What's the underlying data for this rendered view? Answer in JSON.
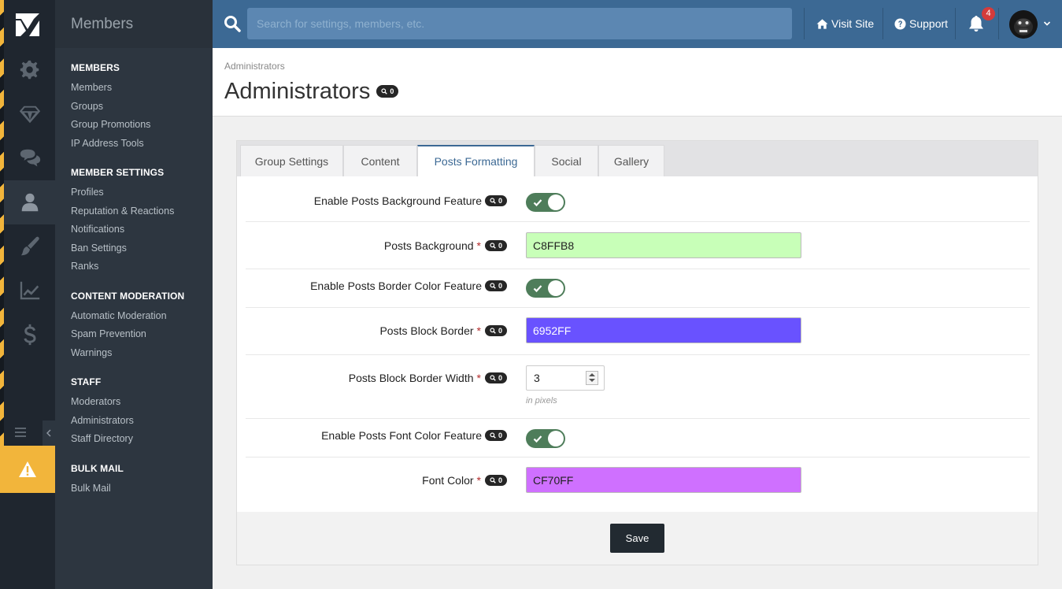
{
  "app": {
    "section_title": "Members"
  },
  "rail": {
    "items": [
      {
        "icon": "gears-icon"
      },
      {
        "icon": "diamond-icon"
      },
      {
        "icon": "chat-icon"
      },
      {
        "icon": "user-icon",
        "active": true
      },
      {
        "icon": "brush-icon"
      },
      {
        "icon": "chart-icon"
      },
      {
        "icon": "dollar-icon"
      }
    ],
    "warning_icon": "warning-icon"
  },
  "sidebar": {
    "sections": [
      {
        "title": "Members",
        "items": [
          "Members",
          "Groups",
          "Group Promotions",
          "IP Address Tools"
        ]
      },
      {
        "title": "Member Settings",
        "items": [
          "Profiles",
          "Reputation & Reactions",
          "Notifications",
          "Ban Settings",
          "Ranks"
        ]
      },
      {
        "title": "Content Moderation",
        "items": [
          "Automatic Moderation",
          "Spam Prevention",
          "Warnings"
        ]
      },
      {
        "title": "Staff",
        "items": [
          "Moderators",
          "Administrators",
          "Staff Directory"
        ]
      },
      {
        "title": "Bulk Mail",
        "items": [
          "Bulk Mail"
        ]
      }
    ]
  },
  "header": {
    "search_placeholder": "Search for settings, members, etc.",
    "visit_site": "Visit Site",
    "support": "Support",
    "notification_count": "4"
  },
  "page": {
    "breadcrumb": "Administrators",
    "title": "Administrators",
    "title_badge": "0"
  },
  "tabs": [
    {
      "label": "Group Settings"
    },
    {
      "label": "Content"
    },
    {
      "label": "Posts Formatting",
      "active": true
    },
    {
      "label": "Social"
    },
    {
      "label": "Gallery"
    }
  ],
  "form": {
    "rows": {
      "enable_bg": {
        "label": "Enable Posts Background Feature",
        "badge": "0",
        "enabled": true
      },
      "posts_bg": {
        "label": "Posts Background",
        "badge": "0",
        "value": "C8FFB8",
        "color": "#C8FFB8"
      },
      "enable_border": {
        "label": "Enable Posts Border Color Feature",
        "badge": "0",
        "enabled": true
      },
      "block_border": {
        "label": "Posts Block Border",
        "badge": "0",
        "value": "6952FF",
        "color": "#6952FF"
      },
      "border_width": {
        "label": "Posts Block Border Width",
        "badge": "0",
        "value": "3",
        "help": "in pixels"
      },
      "enable_font": {
        "label": "Enable Posts Font Color Feature",
        "badge": "0",
        "enabled": true
      },
      "font_color": {
        "label": "Font Color",
        "badge": "0",
        "value": "CF70FF",
        "color": "#CF70FF"
      }
    },
    "required_mark": "*",
    "save_label": "Save"
  },
  "colors": {
    "header_blue": "#3c6994",
    "toggle_on": "#4e7d5a",
    "warning_yellow": "#f2b53b"
  }
}
